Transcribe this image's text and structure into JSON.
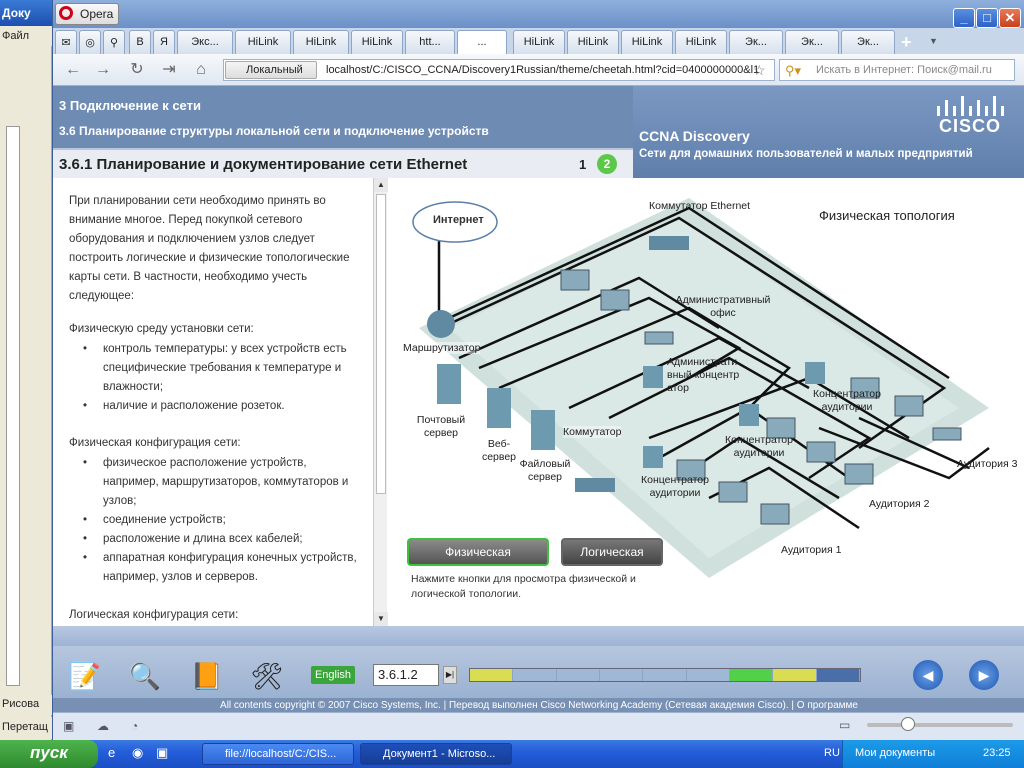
{
  "word": {
    "title": "Доку",
    "menu": "Файл",
    "bottom1": "Рисова",
    "bottom2": "Перетащ"
  },
  "browser": {
    "app_name": "Opera",
    "tabs": [
      "Экс...",
      "HiLink",
      "HiLink",
      "HiLink",
      "htt...",
      "...",
      "HiLink",
      "HiLink",
      "HiLink",
      "HiLink",
      "Эк...",
      "Эк...",
      "Эк..."
    ],
    "address_mode": "Локальный",
    "address": "localhost/C:/CISCO_CCNA/Discovery1Russian/theme/cheetah.html?cid=0400000000&l1",
    "search_placeholder": "Искать в Интернет: Поиск@mail.ru"
  },
  "header": {
    "chapter": "3 Подключение к сети",
    "section": "3.6 Планирование структуры локальной сети и подключение устройств",
    "page_title": "3.6.1 Планирование и документирование сети Ethernet",
    "page_1": "1",
    "page_2": "2",
    "course": "CCNA Discovery",
    "course_sub": "Сети для домашних пользователей и малых предприятий",
    "logo_text": "CISCO"
  },
  "content": {
    "intro": "При планировании сети необходимо принять во внимание многое. Перед покупкой сетевого оборудования и подключением узлов следует построить логические и физические топологические карты сети. В частности, необходимо учесть следующее:",
    "h1": "Физическую среду установки сети:",
    "b1": [
      "контроль температуры: у всех устройств есть специфические требования к температуре и влажности;",
      "наличие и расположение розеток."
    ],
    "h2": "Физическая конфигурация сети:",
    "b2": [
      "физическое расположение устройств, например, маршрутизаторов, коммутаторов и узлов;",
      "соединение устройств;",
      "расположение и длина всех кабелей;",
      "аппаратная конфигурация конечных устройств, например, узлов и серверов."
    ],
    "h3": "Логическая конфигурация сети:"
  },
  "diagram": {
    "title": "Физическая топология",
    "internet": "Интернет",
    "router": "Маршрутизатор",
    "switch_eth": "Коммутатор Ethernet",
    "admin_office": "Административный офис",
    "admin_hub": "Административный концентратор",
    "mail_server": "Почтовый сервер",
    "web_server": "Веб-сервер",
    "file_server": "Файловый сервер",
    "switch": "Коммутатор",
    "hub_aud": "Концентратор аудитории",
    "aud1": "Аудитория 1",
    "aud2": "Аудитория 2",
    "aud3": "Аудитория 3",
    "btn_physical": "Физическая",
    "btn_logical": "Логическая",
    "hint": "Нажмите кнопки для просмотра физической и логической топологии."
  },
  "footer": {
    "language": "English",
    "page_field": "3.6.1.2",
    "copyright": "All contents copyright © 2007 Cisco Systems, Inc. | Перевод выполнен Cisco Networking Academy (Сетевая академия Cisco). | О программе",
    "progress_colors": [
      "#d8dd52",
      "#9fb8d6",
      "#9fb8d6",
      "#9fb8d6",
      "#9fb8d6",
      "#9fb8d6",
      "#52d04a",
      "#d8dd52",
      "#4a6ea8"
    ]
  },
  "taskbar": {
    "start": "пуск",
    "task1": "file://localhost/C:/CIS...",
    "task2": "Документ1 - Microso...",
    "lang": "RU",
    "docs": "Мои документы",
    "time": "23:25"
  }
}
